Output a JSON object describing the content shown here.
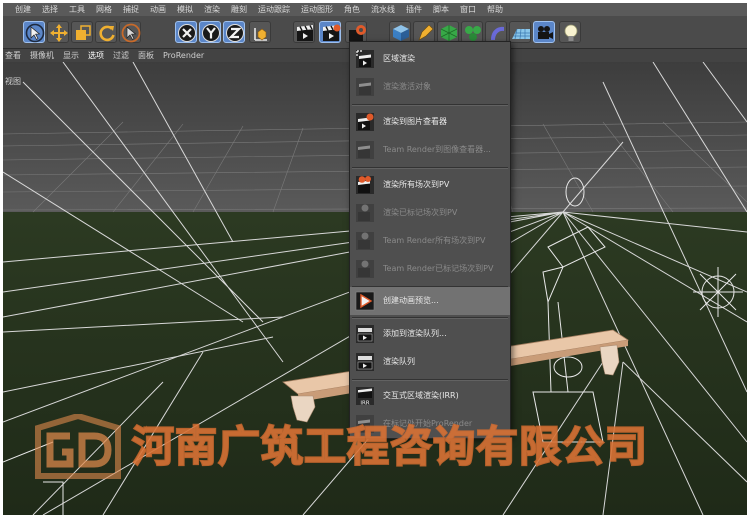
{
  "menubar": {
    "items": [
      "创建",
      "选择",
      "工具",
      "网格",
      "捕捉",
      "动画",
      "模拟",
      "渲染",
      "雕刻",
      "运动跟踪",
      "运动图形",
      "角色",
      "流水线",
      "插件",
      "脚本",
      "窗口",
      "帮助"
    ]
  },
  "viewbar": {
    "items": [
      "查看",
      "摄像机",
      "显示",
      "选项",
      "过滤",
      "面板",
      "ProRender"
    ],
    "selected": "选项"
  },
  "viewport": {
    "label": "视图"
  },
  "toolbar": {
    "tools": [
      "live-selection",
      "move",
      "scale",
      "rotate",
      "recent-tool",
      "x-axis-lock",
      "y-axis-lock",
      "z-axis-lock",
      "coordinate-system",
      "render-view",
      "render-picture-viewer",
      "render-settings",
      "cube",
      "pen",
      "subdivision",
      "array",
      "deformer",
      "floor",
      "camera",
      "light"
    ]
  },
  "render_menu": {
    "items": [
      {
        "label": "区域渲染",
        "enabled": true,
        "icon": "region-render-icon"
      },
      {
        "label": "渲染激活对象",
        "enabled": false,
        "icon": "render-active-objects-icon"
      },
      {
        "label": "渲染到图片查看器",
        "enabled": true,
        "icon": "render-to-picture-viewer-icon"
      },
      {
        "label": "Team Render到图像查看器...",
        "enabled": false,
        "icon": "team-render-viewer-icon"
      },
      {
        "label": "渲染所有场次到PV",
        "enabled": true,
        "icon": "render-all-takes-icon"
      },
      {
        "label": "渲染已标记场次到PV",
        "enabled": false,
        "icon": "render-marked-takes-icon"
      },
      {
        "label": "Team Render所有场次到PV",
        "enabled": false,
        "icon": "team-render-all-takes-icon"
      },
      {
        "label": "Team Render已标记场次到PV",
        "enabled": false,
        "icon": "team-render-marked-takes-icon"
      },
      {
        "label": "创建动画预览...",
        "enabled": true,
        "highlighted": true,
        "icon": "make-preview-icon"
      },
      {
        "label": "添加到渲染队列...",
        "enabled": true,
        "icon": "add-to-render-queue-icon"
      },
      {
        "label": "渲染队列",
        "enabled": true,
        "icon": "render-queue-icon"
      },
      {
        "label": "交互式区域渲染(IRR)",
        "enabled": true,
        "icon": "interactive-render-region-icon",
        "badge": "IRR"
      },
      {
        "label": "在标记处开始ProRender",
        "enabled": false,
        "icon": "prorender-icon"
      }
    ]
  },
  "watermark": {
    "text": "河南广筑工程咨询有限公司",
    "logo_letters": "GD",
    "color": "#e08a4c"
  },
  "colors": {
    "viewport_sky": "#4a4a4a",
    "viewport_floor": "#28351f",
    "grid_lines": "#a8a8a8",
    "toolbar_active": "#5b86c8",
    "menu_bg": "#4f4f4f",
    "menu_highlight": "#727272"
  }
}
